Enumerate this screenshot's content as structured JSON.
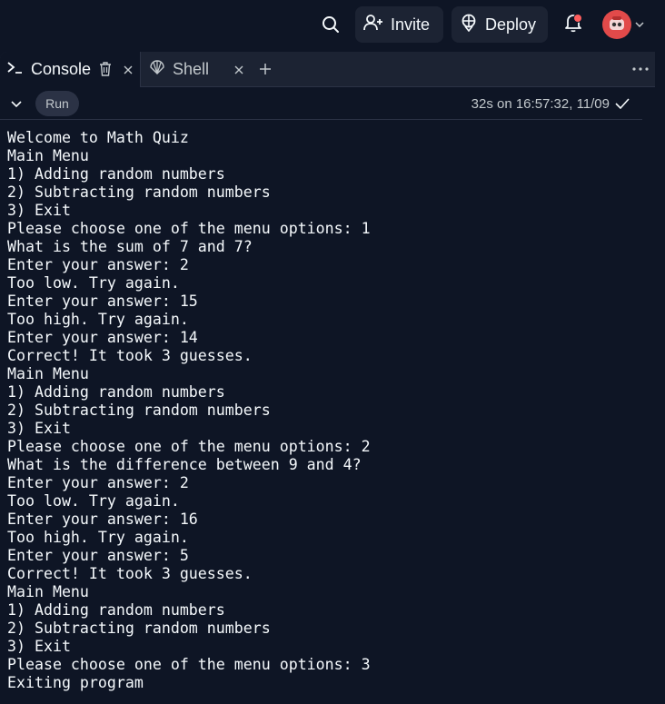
{
  "topbar": {
    "invite_label": "Invite",
    "deploy_label": "Deploy"
  },
  "tabs": [
    {
      "label": "Console"
    },
    {
      "label": "Shell"
    }
  ],
  "runbar": {
    "run_label": "Run",
    "status": "32s on 16:57:32, 11/09"
  },
  "console_lines": [
    "Welcome to Math Quiz",
    "Main Menu",
    "1) Adding random numbers",
    "2) Subtracting random numbers",
    "3) Exit",
    "Please choose one of the menu options: 1",
    "What is the sum of 7 and 7?",
    "Enter your answer: 2",
    "Too low. Try again.",
    "Enter your answer: 15",
    "Too high. Try again.",
    "Enter your answer: 14",
    "Correct! It took 3 guesses.",
    "Main Menu",
    "1) Adding random numbers",
    "2) Subtracting random numbers",
    "3) Exit",
    "Please choose one of the menu options: 2",
    "What is the difference between 9 and 4?",
    "Enter your answer: 2",
    "Too low. Try again.",
    "Enter your answer: 16",
    "Too high. Try again.",
    "Enter your answer: 5",
    "Correct! It took 3 guesses.",
    "Main Menu",
    "1) Adding random numbers",
    "2) Subtracting random numbers",
    "3) Exit",
    "Please choose one of the menu options: 3",
    "Exiting program"
  ],
  "colors": {
    "background": "#0e1525",
    "panel": "#1c2333",
    "text": "#f5f9fc",
    "muted": "#c2c8cc",
    "notification": "#fd5d5d",
    "avatar": "#e24a4a"
  },
  "icons": [
    "search-icon",
    "add-user-icon",
    "deploy-icon",
    "bell-icon",
    "avatar",
    "chevron-down-icon",
    "terminal-icon",
    "trash-icon",
    "close-icon",
    "shell-icon",
    "plus-icon",
    "more-icon",
    "check-icon"
  ]
}
